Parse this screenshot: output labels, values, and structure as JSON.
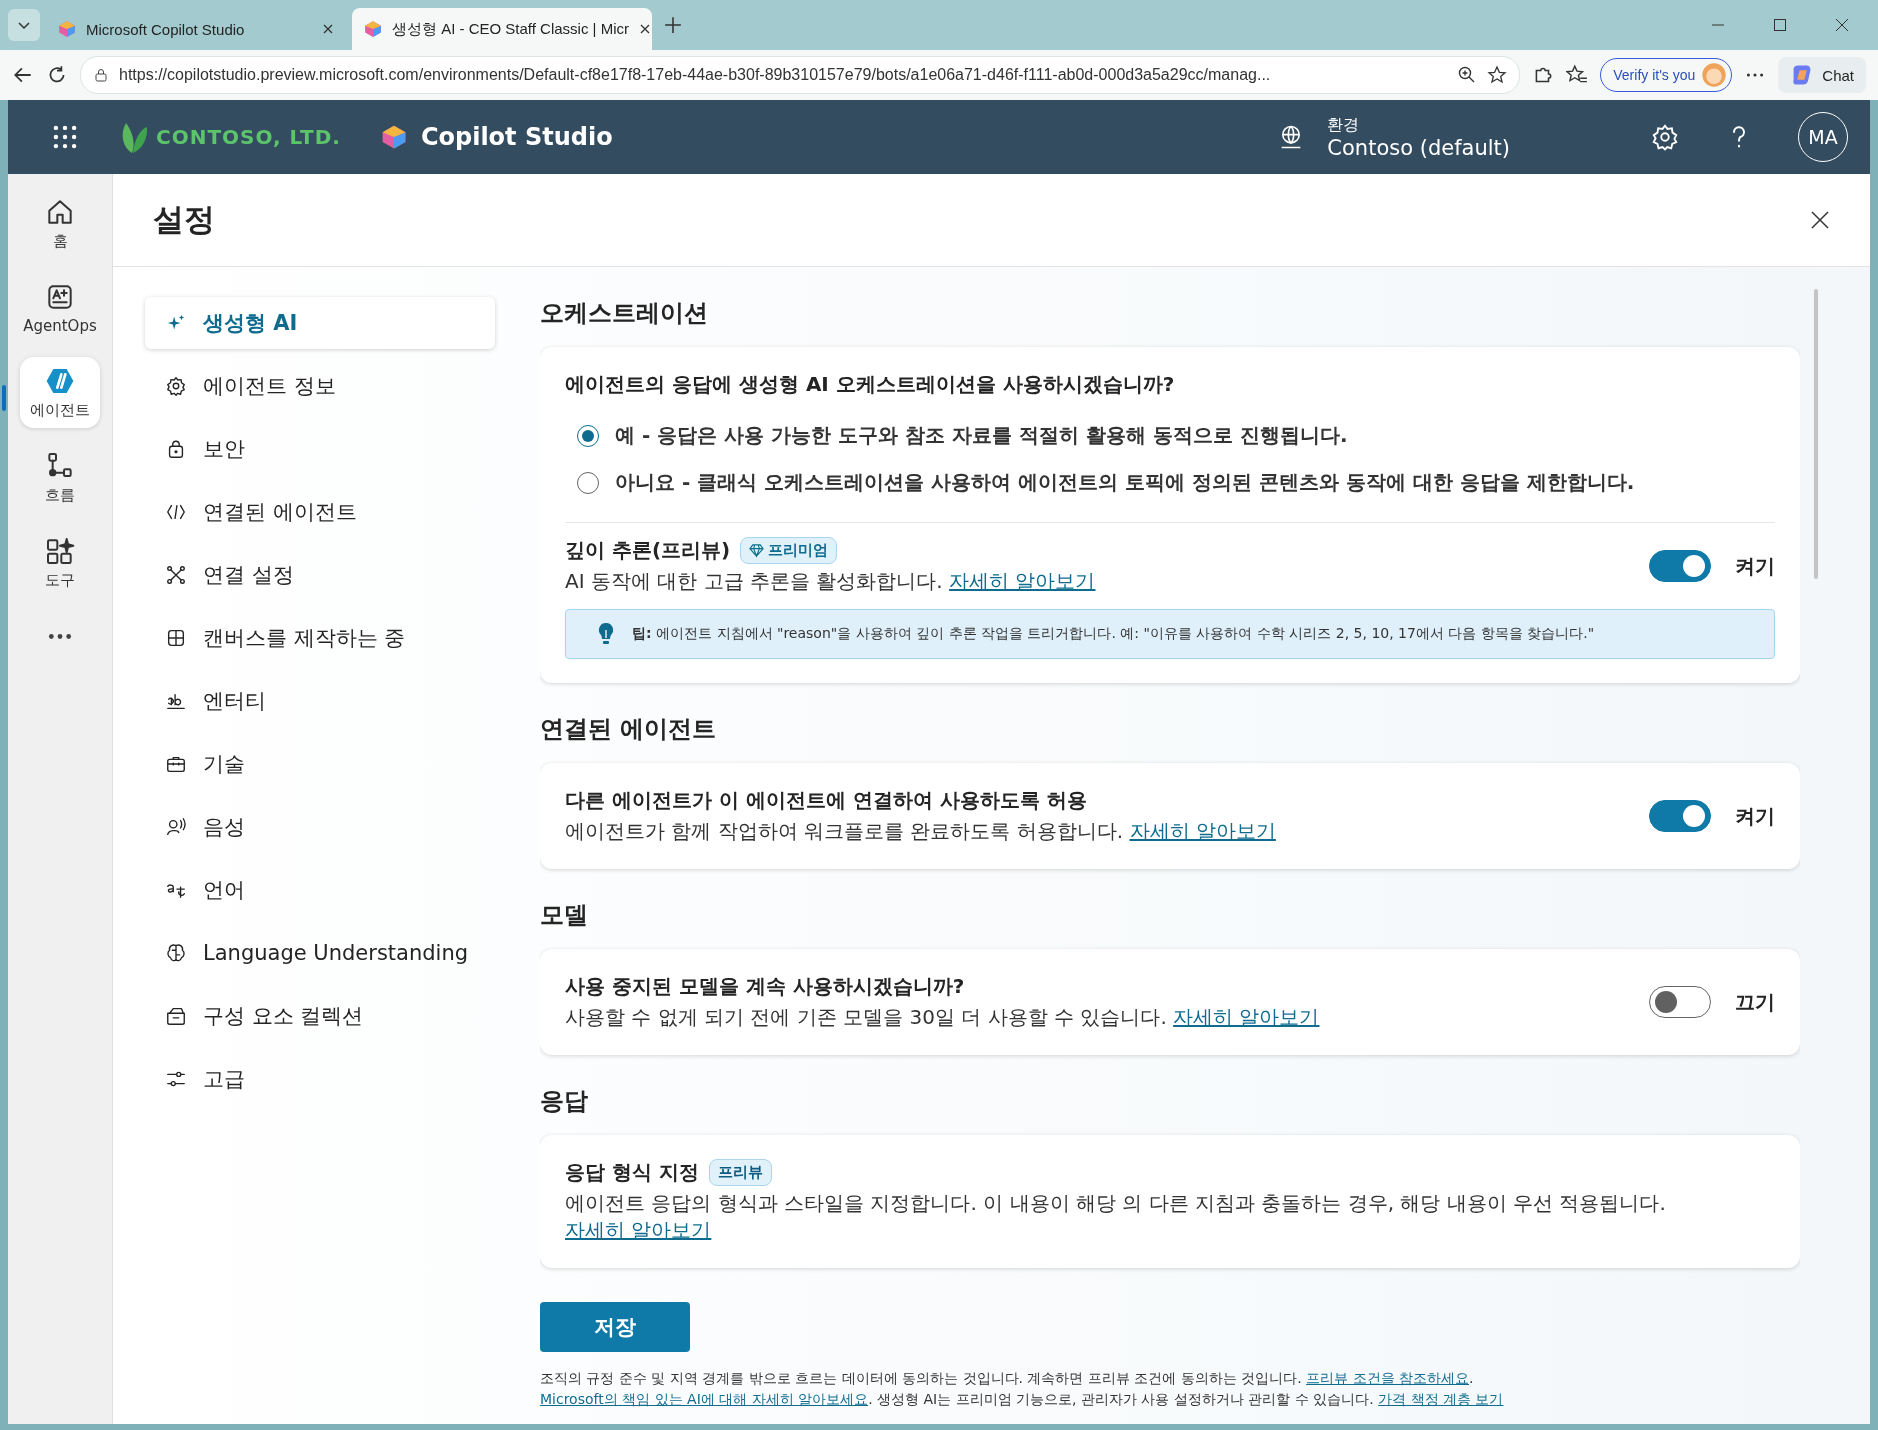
{
  "browser": {
    "tabs": [
      {
        "title": "Microsoft Copilot Studio",
        "selected": false
      },
      {
        "title": "생성형 AI - CEO Staff Classic | Micr",
        "selected": true
      }
    ],
    "address": "https://copilotstudio.preview.microsoft.com/environments/Default-cf8e17f8-17eb-44ae-b30f-89b310157e79/bots/a1e06a71-d46f-f111-ab0d-000d3a5a29cc/manag...",
    "verify": "Verify it's you",
    "chat": "Chat"
  },
  "header": {
    "brand": "CONTOSO, LTD.",
    "product": "Copilot Studio",
    "env_label": "환경",
    "env_name": "Contoso (default)",
    "avatar": "MA"
  },
  "rail": [
    {
      "label": "홈",
      "selected": false
    },
    {
      "label": "AgentOps",
      "selected": false
    },
    {
      "label": "에이전트",
      "selected": true
    },
    {
      "label": "흐름",
      "selected": false
    },
    {
      "label": "도구",
      "selected": false
    }
  ],
  "settings": {
    "title": "설정"
  },
  "nav": [
    {
      "label": "생성형 AI",
      "selected": true
    },
    {
      "label": "에이전트 정보",
      "selected": false
    },
    {
      "label": "보안",
      "selected": false
    },
    {
      "label": "연결된 에이전트",
      "selected": false
    },
    {
      "label": "연결 설정",
      "selected": false
    },
    {
      "label": "캔버스를 제작하는 중",
      "selected": false
    },
    {
      "label": "엔터티",
      "selected": false
    },
    {
      "label": "기술",
      "selected": false
    },
    {
      "label": "음성",
      "selected": false
    },
    {
      "label": "언어",
      "selected": false
    },
    {
      "label": "Language Understanding",
      "selected": false
    },
    {
      "label": "구성 요소 컬렉션",
      "selected": false
    },
    {
      "label": "고급",
      "selected": false
    }
  ],
  "sections": [
    {
      "heading": "오케스트레이션",
      "items": [
        {
          "kind": "radio_group",
          "question": "에이전트의 응답에 생성형 AI 오케스트레이션을 사용하시겠습니까?",
          "options": [
            {
              "label": "예 - 응답은 사용 가능한 도구와 참조 자료를 적절히 활용해 동적으로 진행됩니다.",
              "selected": true
            },
            {
              "label": "아니요 - 클래식 오케스트레이션을 사용하여 에이전트의 토픽에 정의된 콘텐츠와 동작에 대한 응답을 제한합니다.",
              "selected": false
            }
          ]
        },
        {
          "kind": "toggle",
          "title": "깊이 추론(프리뷰)",
          "badge": {
            "text": "프리미엄",
            "kind": "premium"
          },
          "description": "AI 동작에 대한 고급 추론을 활성화합니다.",
          "link": "자세히 알아보기",
          "on": true,
          "state_label": "켜기",
          "tip": {
            "label": "팁:",
            "text": "에이전트 지침에서 \"reason\"을 사용하여 깊이 추론 작업을 트리거합니다. 예: \"이유를 사용하여 수학 시리즈 2, 5, 10, 17에서 다음 항목을 찾습니다.\""
          }
        }
      ]
    },
    {
      "heading": "연결된 에이전트",
      "items": [
        {
          "kind": "toggle",
          "title": "다른 에이전트가 이 에이전트에 연결하여 사용하도록 허용",
          "description": "에이전트가 함께 작업하여 워크플로를 완료하도록 허용합니다.",
          "link": "자세히 알아보기",
          "on": true,
          "state_label": "켜기"
        }
      ]
    },
    {
      "heading": "모델",
      "items": [
        {
          "kind": "toggle",
          "title": "사용 중지된 모델을 계속 사용하시겠습니까?",
          "description": "사용할 수 없게 되기 전에 기존 모델을 30일 더 사용할 수 있습니다.",
          "link": "자세히 알아보기",
          "on": false,
          "state_label": "끄기"
        }
      ]
    },
    {
      "heading": "응답",
      "items": [
        {
          "kind": "text",
          "title": "응답 형식 지정",
          "badge": {
            "text": "프리뷰",
            "kind": "preview"
          },
          "description": "에이전트 응답의 형식과 스타일을 지정합니다. 이 내용이 해당 의 다른 지침과 충돌하는 경우, 해당 내용이 우선 적용됩니다.",
          "link": "자세히 알아보기"
        }
      ]
    }
  ],
  "footer": {
    "save": "저장",
    "notice": [
      {
        "kind": "text",
        "text": "조직의 규정 준수 및 지역 경계를 밖으로 흐르는 데이터에 동의하는 것입니다. 계속하면 프리뷰 조건에 동의하는 것입니다. "
      },
      {
        "kind": "link",
        "text": "프리뷰 조건을 참조하세요"
      },
      {
        "kind": "text",
        "text": ". "
      },
      {
        "kind": "link",
        "text": "Microsoft의 책임 있는 AI에 대해 자세히 알아보세요"
      },
      {
        "kind": "text",
        "text": ". 생성형 AI는 프리미엄 기능으로, 관리자가 사용 설정하거나 관리할 수 있습니다. "
      },
      {
        "kind": "link",
        "text": "가격 책정 계층 보기"
      }
    ]
  }
}
